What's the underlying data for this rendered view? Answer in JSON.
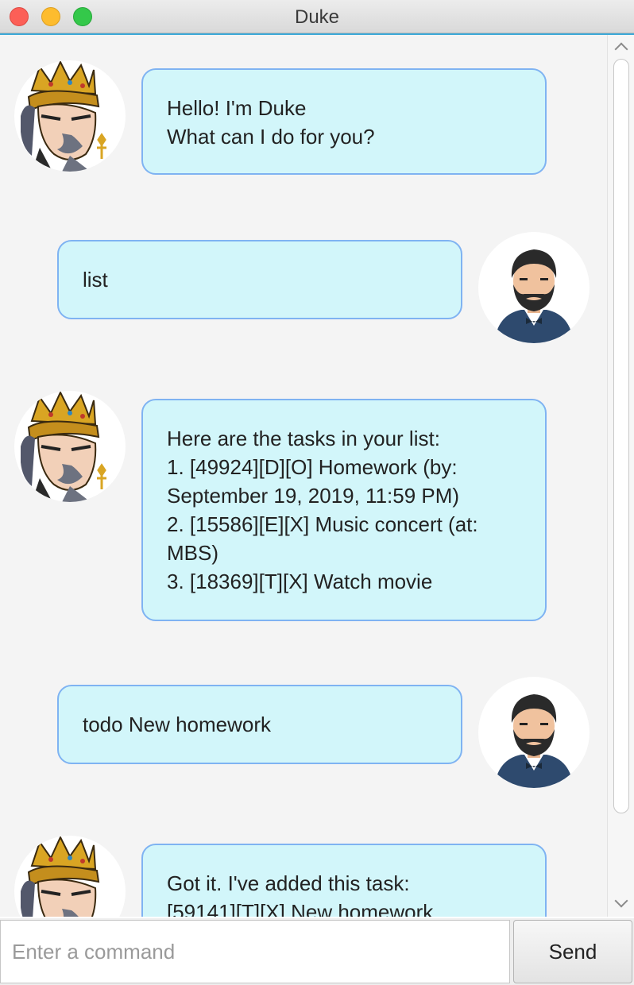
{
  "window": {
    "title": "Duke"
  },
  "chat": {
    "messages": [
      {
        "sender": "duke",
        "text": "Hello! I'm Duke\nWhat can I do for you?"
      },
      {
        "sender": "user",
        "text": "list"
      },
      {
        "sender": "duke",
        "text": "Here are the tasks in your list:\n1. [49924][D][O] Homework (by: September 19, 2019, 11:59 PM)\n2. [15586][E][X] Music concert (at: MBS)\n3. [18369][T][X] Watch movie"
      },
      {
        "sender": "user",
        "text": "todo New homework"
      },
      {
        "sender": "duke",
        "text": "Got it. I've added this task:\n  [59141][T][X] New homework"
      }
    ]
  },
  "input": {
    "placeholder": "Enter a command",
    "value": "",
    "send_label": "Send"
  },
  "colors": {
    "bubble_fill": "#d2f6fa",
    "bubble_border": "#7fb3f2",
    "accent": "#3da9d8"
  },
  "icons": {
    "duke_avatar": "king-icon",
    "user_avatar": "bearded-man-icon"
  }
}
